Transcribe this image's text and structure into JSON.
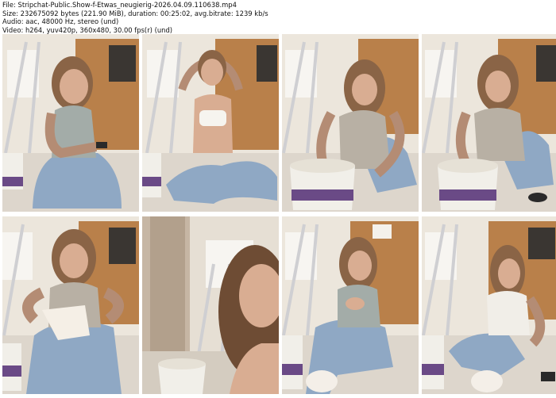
{
  "header": {
    "file_line": "File: Stripchat-Public.Show-f-Etwas_neugierig-2026.04.09.110638.mp4",
    "size_line": "Size: 232675092 bytes (221.90 MiB), duration: 00:25:02, avg.bitrate: 1239 kb/s",
    "audio_line": "Audio: aac, 48000 Hz, stereo (und)",
    "video_line": "Video: h264, yuv420p, 360x480, 30.00 fps(r) (und)"
  },
  "colors": {
    "cabinet": "#b9804a",
    "wall": "#ece6dc",
    "floor": "#ddd6cc",
    "ladder": "#cfcfd2",
    "jeans": "#8fa8c4",
    "hair": "#8a6446",
    "skin": "#d9ad92",
    "bucket": "#f1efe9",
    "bucket_band": "#6a4a86"
  },
  "thumbnails": [
    {
      "scene": "sitting-phone"
    },
    {
      "scene": "hands-in-hair"
    },
    {
      "scene": "bucket-center"
    },
    {
      "scene": "bucket-right"
    },
    {
      "scene": "hands-forward"
    },
    {
      "scene": "close-up"
    },
    {
      "scene": "sitting-bucket-left"
    },
    {
      "scene": "sitting-phone-right"
    }
  ]
}
